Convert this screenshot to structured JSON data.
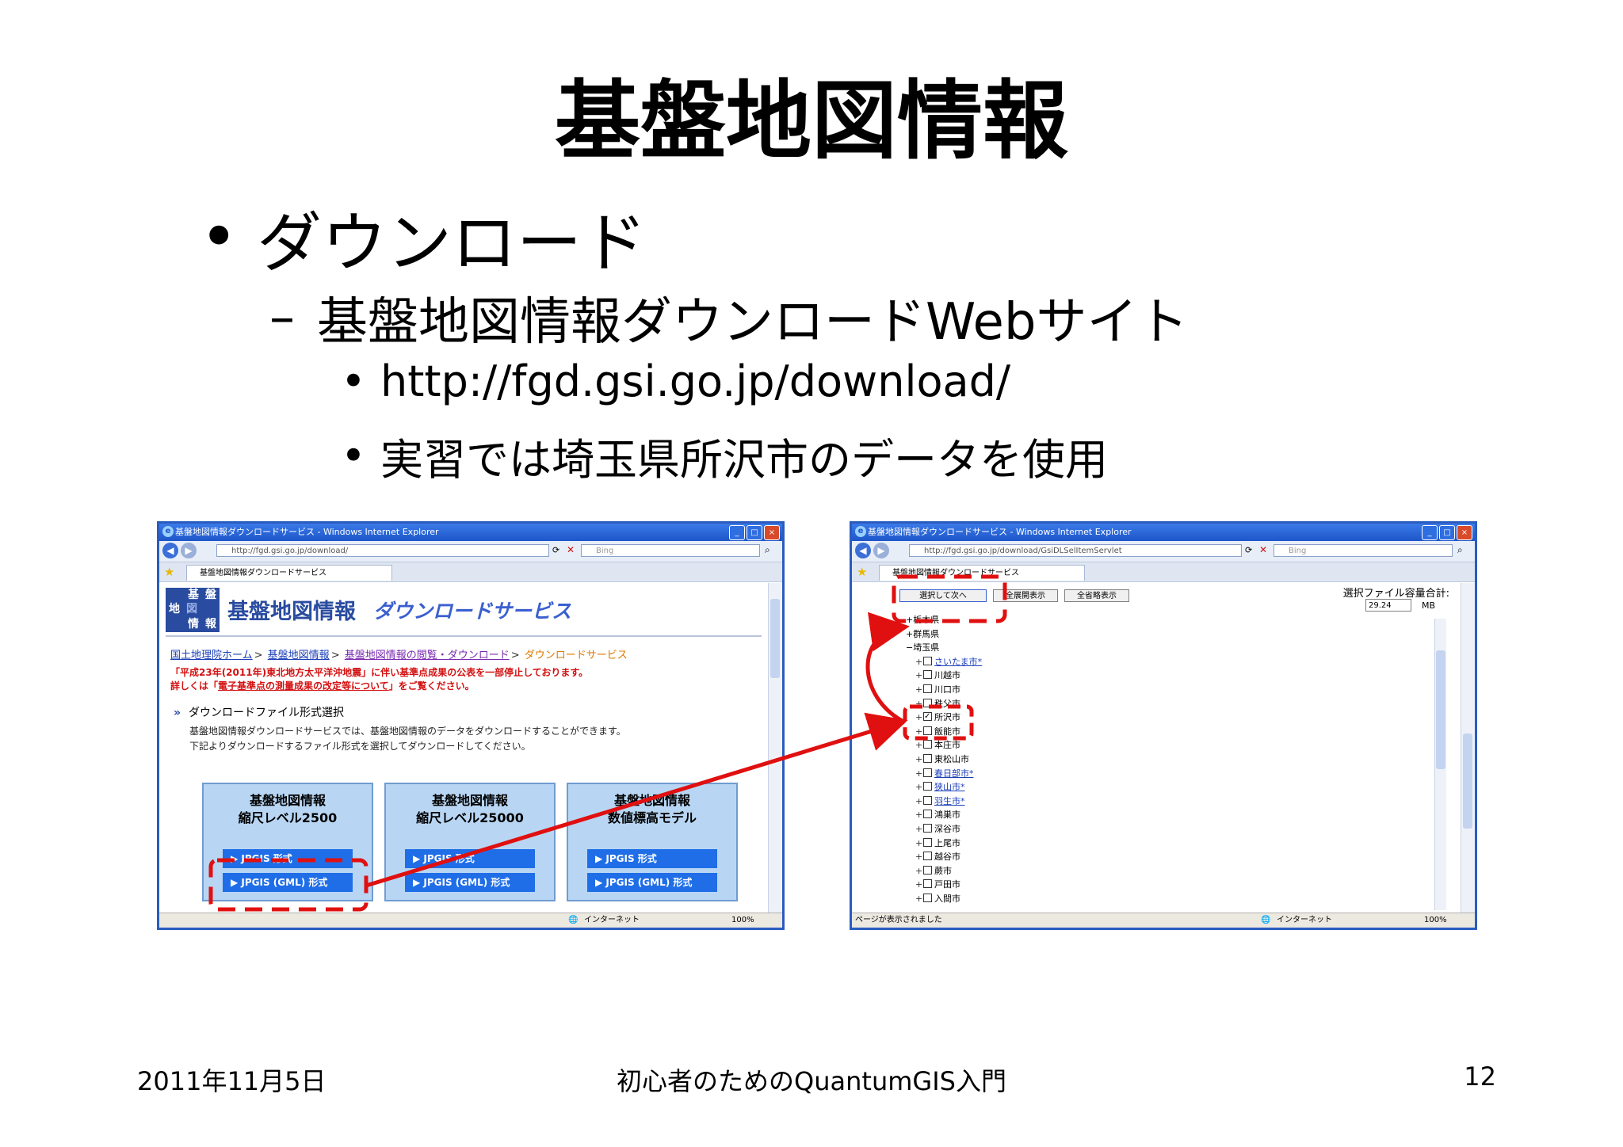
{
  "slide": {
    "title": "基盤地図情報",
    "bullet1": "ダウンロード",
    "bullet2": "基盤地図情報ダウンロードWebサイト",
    "bullet3": "http://fgd.gsi.go.jp/download/",
    "bullet4": "実習では埼玉県所沢市のデータを使用",
    "footer_date": "2011年11月5日",
    "footer_title": "初心者のためのQuantumGIS入門",
    "page_number": "12"
  },
  "marks": {
    "bullet": "•",
    "dash": "–"
  },
  "colors": {
    "annotation_red": "#e01010",
    "ie_blue": "#2a5cbf"
  },
  "window_left": {
    "title": "基盤地図情報ダウンロードサービス - Windows Internet Explorer",
    "address": "http://fgd.gsi.go.jp/download/",
    "search_placeholder": "Bing",
    "tab_label": "基盤地図情報ダウンロードサービス",
    "logo": [
      "基",
      "盤",
      "地",
      "図",
      "情",
      "報"
    ],
    "banner_title": "基盤地図情報",
    "banner_subtitle": "ダウンロードサービス",
    "breadcrumb": [
      "国土地理院ホーム",
      "基盤地図情報",
      "基盤地図情報の閲覧・ダウンロード",
      "ダウンロードサービス"
    ],
    "notice_line1": "「平成23年(2011年)東北地方太平洋沖地震」に伴い基準点成果の公表を一部停止しております。",
    "notice_line2_prefix": "詳しくは「",
    "notice_link": "電子基準点の測量成果の改定等について",
    "notice_line2_suffix": "」をご覧ください。",
    "section_title": "ダウンロードファイル形式選択",
    "desc_line1": "基盤地図情報ダウンロードサービスでは、基盤地図情報のデータをダウンロードすることができます。",
    "desc_line2": "下記よりダウンロードするファイル形式を選択してダウンロードしてください。",
    "cards": [
      {
        "title1": "基盤地図情報",
        "title2": "縮尺レベル2500",
        "btn1": "JPGIS 形式",
        "btn2": "JPGIS (GML) 形式"
      },
      {
        "title1": "基盤地図情報",
        "title2": "縮尺レベル25000",
        "btn1": "JPGIS 形式",
        "btn2": "JPGIS (GML) 形式"
      },
      {
        "title1": "基盤地図情報",
        "title2": "数値標高モデル",
        "btn1": "JPGIS 形式",
        "btn2": "JPGIS (GML) 形式"
      }
    ],
    "status_zone": "インターネット",
    "zoom": "100%"
  },
  "window_right": {
    "title": "基盤地図情報ダウンロードサービス - Windows Internet Explorer",
    "address": "http://fgd.gsi.go.jp/download/GsiDLSelItemServlet",
    "search_placeholder": "Bing",
    "tab_label": "基盤地図情報ダウンロードサービス",
    "btn_next": "選択して次へ",
    "btn_expand": "全展開表示",
    "btn_collapse": "全省略表示",
    "capacity_label": "選択ファイル容量合計:",
    "capacity_value": "29.24",
    "capacity_unit": "MB",
    "prefs": [
      "+栃木県",
      "+群馬県",
      "−埼玉県"
    ],
    "cities": [
      {
        "name": "さいたま市*",
        "link": true,
        "checked": false
      },
      {
        "name": "川越市",
        "link": false,
        "checked": false
      },
      {
        "name": "川口市",
        "link": false,
        "checked": false
      },
      {
        "name": "秩父市",
        "link": false,
        "checked": false
      },
      {
        "name": "所沢市",
        "link": false,
        "checked": true
      },
      {
        "name": "飯能市",
        "link": false,
        "checked": false
      },
      {
        "name": "本庄市",
        "link": false,
        "checked": false
      },
      {
        "name": "東松山市",
        "link": false,
        "checked": false
      },
      {
        "name": "春日部市*",
        "link": true,
        "checked": false
      },
      {
        "name": "狭山市*",
        "link": true,
        "checked": false
      },
      {
        "name": "羽生市*",
        "link": true,
        "checked": false
      },
      {
        "name": "鴻巣市",
        "link": false,
        "checked": false
      },
      {
        "name": "深谷市",
        "link": false,
        "checked": false
      },
      {
        "name": "上尾市",
        "link": false,
        "checked": false
      },
      {
        "name": "越谷市",
        "link": false,
        "checked": false
      },
      {
        "name": "蕨市",
        "link": false,
        "checked": false
      },
      {
        "name": "戸田市",
        "link": false,
        "checked": false
      },
      {
        "name": "入間市",
        "link": false,
        "checked": false
      }
    ],
    "status_text": "ページが表示されました",
    "status_zone": "インターネット",
    "zoom": "100%"
  }
}
